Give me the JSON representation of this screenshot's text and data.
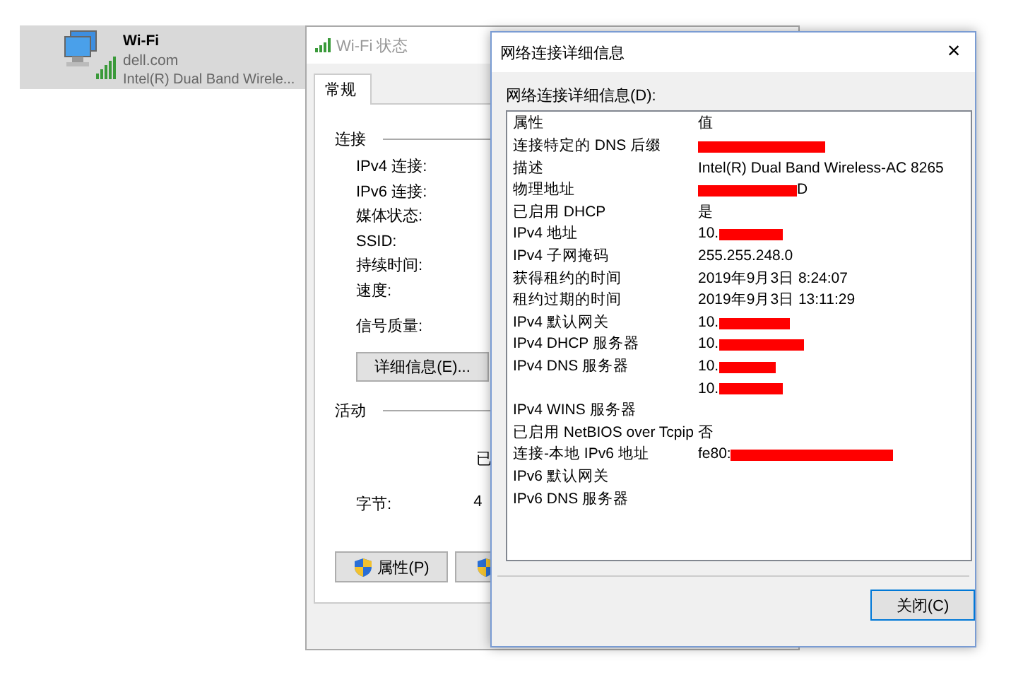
{
  "network_item": {
    "name": "Wi-Fi",
    "domain": "dell.com",
    "adapter": "Intel(R) Dual Band Wirele...",
    "selected": true
  },
  "status_window": {
    "title": "Wi-Fi 状态",
    "active": false,
    "tabs": [
      {
        "label": "常规",
        "selected": true
      }
    ],
    "connection": {
      "title": "连接",
      "fields": [
        "IPv4 连接:",
        "IPv6 连接:",
        "媒体状态:",
        "SSID:",
        "持续时间:",
        "速度:"
      ],
      "signal_label": "信号质量:",
      "details_button": "详细信息(E)..."
    },
    "activity": {
      "title": "活动",
      "sent_label": "已",
      "bytes_label": "字节:",
      "bytes_value": "4"
    },
    "buttons": [
      {
        "label": "属性(P)",
        "shield": true
      },
      {
        "shield": true
      }
    ]
  },
  "details_dialog": {
    "title": "网络连接详细信息",
    "close": "×",
    "active": true,
    "list_label": "网络连接详细信息(D):",
    "columns": [
      "属性",
      "值"
    ],
    "rows": [
      {
        "property": "连接特定的 DNS 后缀",
        "redacted": true
      },
      {
        "property": "描述",
        "value": "Intel(R) Dual Band Wireless-AC 8265",
        "redacted": false
      },
      {
        "property": "物理地址",
        "value_after": "D",
        "redacted": true
      },
      {
        "property": "已启用 DHCP",
        "value": "是",
        "redacted": false
      },
      {
        "property": "IPv4 地址",
        "value": "10.",
        "redacted": true
      },
      {
        "property": "IPv4 子网掩码",
        "value": "255.255.248.0",
        "redacted": false
      },
      {
        "property": "获得租约的时间",
        "value": "2019年9月3日 8:24:07",
        "redacted": false
      },
      {
        "property": "租约过期的时间",
        "value": "2019年9月3日 13:11:29",
        "redacted": false
      },
      {
        "property": "IPv4 默认网关",
        "value": "10.",
        "redacted": true
      },
      {
        "property": "IPv4 DHCP 服务器",
        "value": "10.",
        "redacted": true
      },
      {
        "property": "IPv4 DNS 服务器",
        "value": "10.",
        "redacted": true
      },
      {
        "value": "10.",
        "redacted": true
      },
      {
        "property": "IPv4 WINS 服务器",
        "redacted": false
      },
      {
        "property": "已启用 NetBIOS over Tcpip",
        "value": "否",
        "redacted": false
      },
      {
        "property": "连接-本地 IPv6 地址",
        "value": "fe80:",
        "redacted": true
      },
      {
        "property": "IPv6 默认网关",
        "redacted": false
      },
      {
        "property": "IPv6 DNS 服务器",
        "redacted": false
      }
    ],
    "close_button": "关闭(C)"
  }
}
